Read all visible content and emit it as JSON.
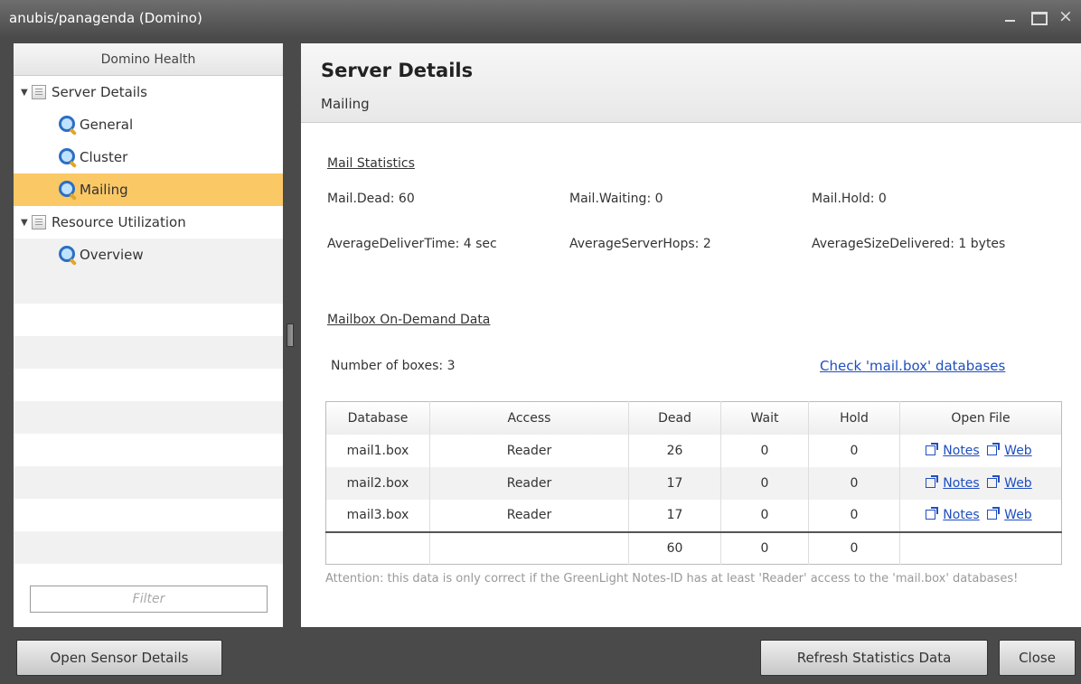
{
  "window": {
    "title": "anubis/panagenda (Domino)",
    "min_icon": "minimize-icon",
    "max_icon": "maximize-icon",
    "close_label": "×"
  },
  "sidebar": {
    "header": "Domino Health",
    "items": [
      {
        "label": "Server Details",
        "type": "folder"
      },
      {
        "label": "General",
        "type": "leaf"
      },
      {
        "label": "Cluster",
        "type": "leaf"
      },
      {
        "label": "Mailing",
        "type": "leaf",
        "selected": true
      },
      {
        "label": "Resource Utilization",
        "type": "folder"
      },
      {
        "label": "Overview",
        "type": "leaf"
      }
    ],
    "filter_placeholder": "Filter"
  },
  "main": {
    "title": "Server Details",
    "subtitle": "Mailing",
    "mail_stats": {
      "heading": "Mail Statistics",
      "dead": "Mail.Dead:  60",
      "waiting": "Mail.Waiting:  0",
      "hold": "Mail.Hold:  0",
      "avg_deliver": "AverageDeliverTime:  4 sec",
      "avg_hops": "AverageServerHops:  2",
      "avg_size": "AverageSizeDelivered:  1 bytes"
    },
    "mailbox": {
      "heading": "Mailbox On-Demand Data",
      "num_boxes": "Number of boxes:  3",
      "check_link": "Check 'mail.box' databases",
      "columns": [
        "Database",
        "Access",
        "Dead",
        "Wait",
        "Hold",
        "Open File"
      ],
      "rows": [
        {
          "database": "mail1.box",
          "access": "Reader",
          "dead": "26",
          "wait": "0",
          "hold": "0"
        },
        {
          "database": "mail2.box",
          "access": "Reader",
          "dead": "17",
          "wait": "0",
          "hold": "0"
        },
        {
          "database": "mail3.box",
          "access": "Reader",
          "dead": "17",
          "wait": "0",
          "hold": "0"
        }
      ],
      "totals": {
        "dead": "60",
        "wait": "0",
        "hold": "0"
      },
      "open_notes": "Notes",
      "open_web": "Web",
      "note": "Attention: this data is only correct if the GreenLight Notes-ID has at least 'Reader' access to the 'mail.box' databases!"
    }
  },
  "footer": {
    "open_sensor": "Open Sensor Details",
    "refresh": "Refresh Statistics Data",
    "close": "Close"
  }
}
